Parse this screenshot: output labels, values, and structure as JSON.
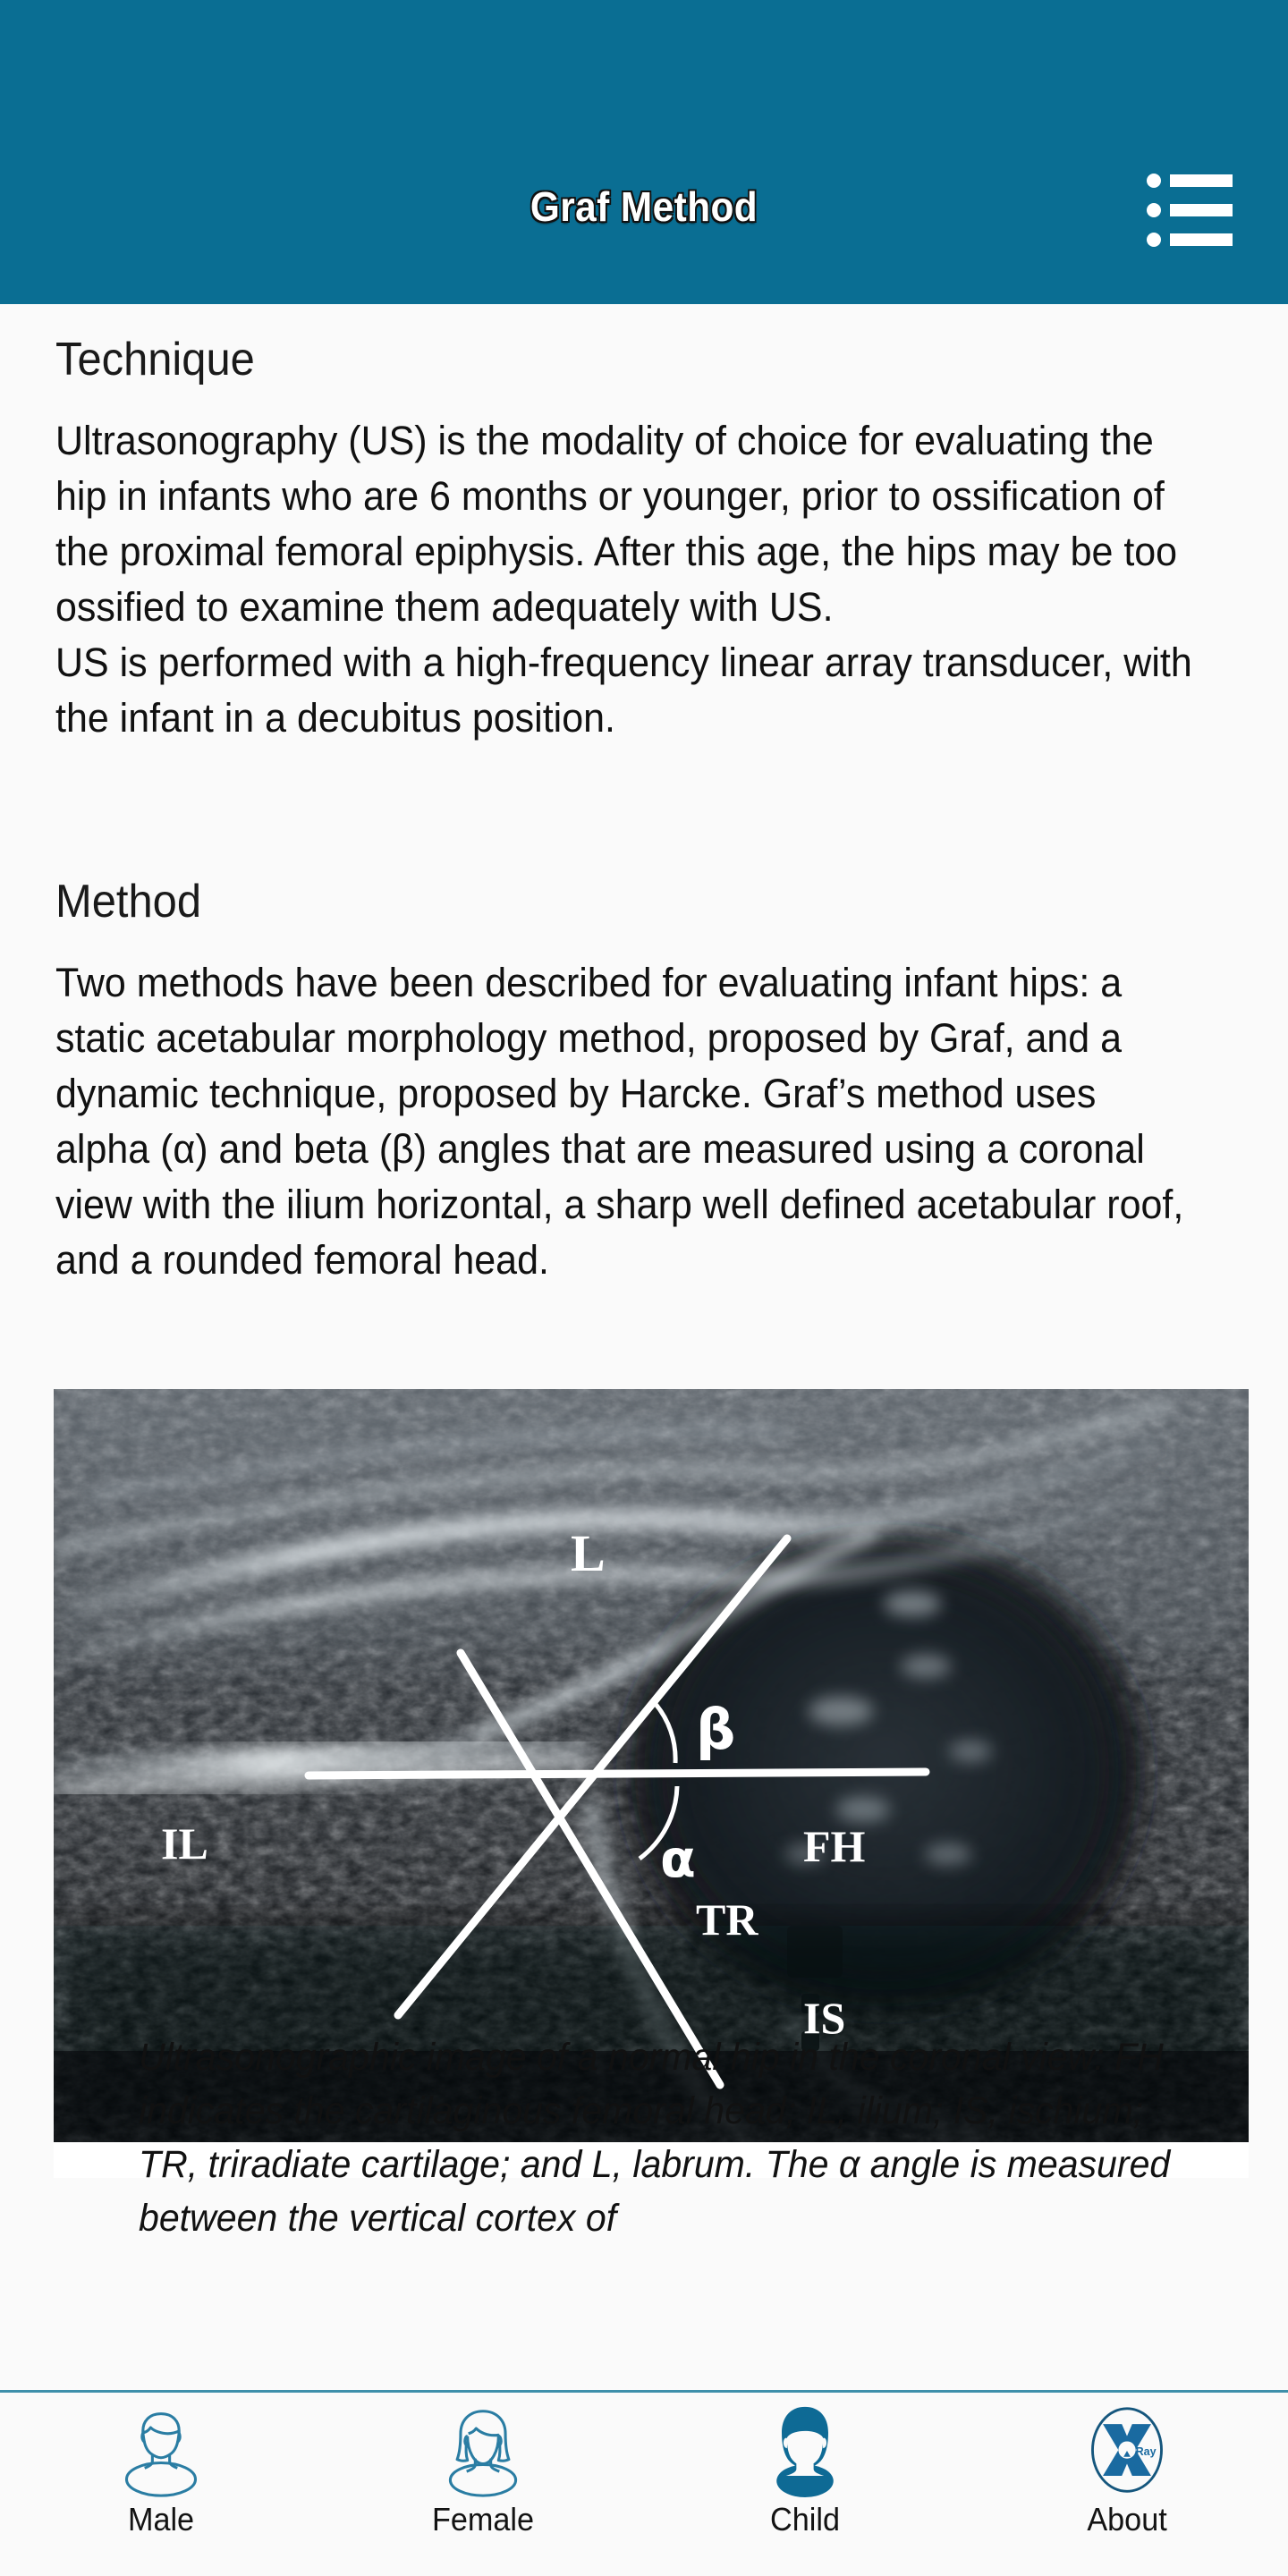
{
  "header": {
    "title": "Graf Method",
    "background_color": "#0a6e93",
    "menu_icon": "list-menu-icon"
  },
  "content": {
    "sections": [
      {
        "heading": "Technique",
        "body": "Ultrasonography (US) is the modality of choice for evaluating the hip in infants who are 6 months or younger, prior to ossification of the proximal femoral epiphysis. After this age, the hips may be too ossified to examine them adequately with US.\nUS is performed with a high-frequency linear array transducer, with the infant in a decubitus position."
      },
      {
        "heading": "Method",
        "body": "Two methods have been described for evaluating infant hips: a static acetabular morphology method, proposed by Graf, and a dynamic technique, proposed by Harcke. Graf’s method uses alpha (α) and beta (β) angles that are measured using a coronal view with the ilium horizontal, a sharp well defined acetabular roof, and a rounded femoral head."
      }
    ],
    "figure": {
      "alt": "ultrasound-hip-coronal-view",
      "annotations": {
        "labrum": "L",
        "beta_angle": "β",
        "alpha_angle": "α",
        "ilium": "IL",
        "femoral_head": "FH",
        "triradiate_cartilage": "TR",
        "ischium": "IS"
      },
      "caption": "Ultrasonographic image of a normal hip in the coronal view: FH indicates the cartilaginous femoral head; IL, ilium; IS, ischium; TR, triradiate cartilage; and L, labrum. The α angle is measured between the vertical cortex of"
    }
  },
  "bottom_nav": {
    "accent_color": "#0a6e93",
    "items": [
      {
        "label": "Male",
        "icon": "male-person-icon",
        "active": false
      },
      {
        "label": "Female",
        "icon": "female-person-icon",
        "active": false
      },
      {
        "label": "Child",
        "icon": "child-person-icon",
        "active": true
      },
      {
        "label": "About",
        "icon": "xray-logo-icon",
        "active": false
      }
    ]
  }
}
